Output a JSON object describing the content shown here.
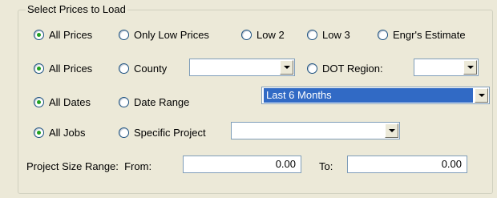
{
  "group_title": "Select Prices to Load",
  "row1": {
    "options": [
      {
        "label": "All Prices",
        "checked": true
      },
      {
        "label": "Only Low Prices",
        "checked": false
      },
      {
        "label": "Low 2",
        "checked": false
      },
      {
        "label": "Low 3",
        "checked": false
      },
      {
        "label": "Engr's Estimate",
        "checked": false
      }
    ]
  },
  "row2": {
    "all_prices_label": "All Prices",
    "county_label": "County",
    "county_value": "",
    "dot_region_label": "DOT Region:",
    "dot_region_value": ""
  },
  "row3": {
    "all_dates_label": "All Dates",
    "date_range_label": "Date Range",
    "date_range_value": "Last 6 Months"
  },
  "row4": {
    "all_jobs_label": "All Jobs",
    "specific_project_label": "Specific Project",
    "specific_project_value": ""
  },
  "row5": {
    "size_range_label": "Project Size Range:  From:",
    "from_value": "0.00",
    "to_label": "To:",
    "to_value": "0.00"
  },
  "colors": {
    "background": "#ece9d8",
    "selection": "#316ac5",
    "radio_dot": "#21a121"
  }
}
